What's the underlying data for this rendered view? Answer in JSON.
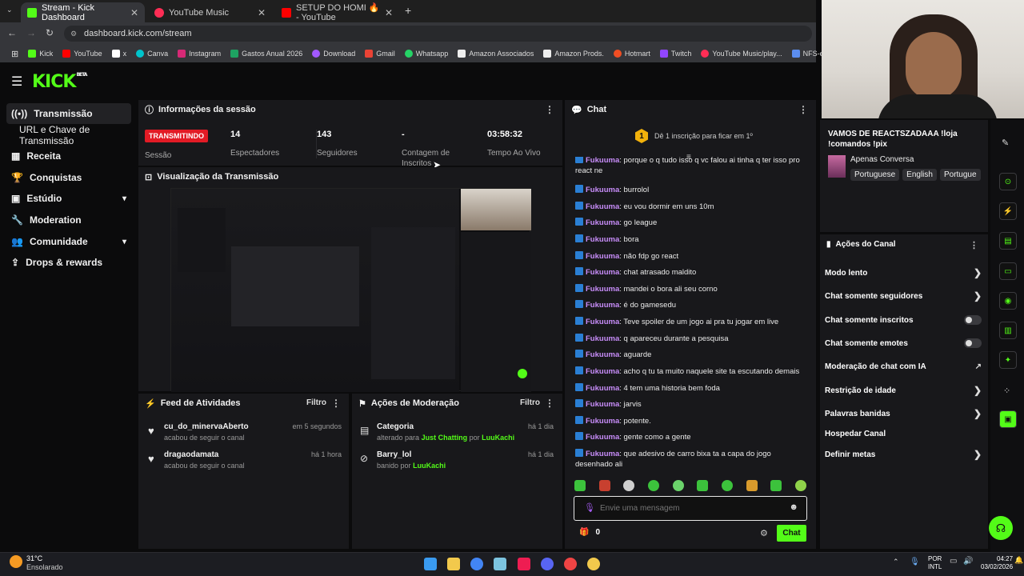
{
  "browser": {
    "tabs": [
      {
        "title": "Stream - Kick Dashboard",
        "close": "✕"
      },
      {
        "title": "YouTube Music",
        "close": "✕"
      },
      {
        "title": "SETUP DO HOMI 🔥 - YouTube",
        "close": "✕"
      }
    ],
    "new_tab": "+",
    "url": "dashboard.kick.com/stream",
    "bookmarks": [
      "Kick",
      "YouTube",
      "x",
      "Canva",
      "Instagram",
      "Gastos Anual 2026",
      "Download",
      "Gmail",
      "Whatsapp",
      "Amazon Associados",
      "Amazon Prods.",
      "Hotmart",
      "Twitch",
      "YouTube Music/play...",
      "NFS-e | JOÃO PESS..."
    ]
  },
  "brand": {
    "logo": "KICK",
    "beta": "BETA",
    "accent": "#53fc18"
  },
  "sidebar": {
    "items": [
      {
        "label": "Transmissão",
        "icon": "broadcast-icon"
      },
      {
        "label": "URL e Chave de Transmissão"
      },
      {
        "label": "Receita",
        "icon": "revenue-icon"
      },
      {
        "label": "Conquistas",
        "icon": "trophy-icon"
      },
      {
        "label": "Estúdio",
        "icon": "studio-icon",
        "chevron": "▾"
      },
      {
        "label": "Moderation",
        "icon": "wrench-icon"
      },
      {
        "label": "Comunidade",
        "icon": "community-icon",
        "chevron": "▾"
      },
      {
        "label": "Drops & rewards",
        "icon": "drops-icon"
      }
    ]
  },
  "session": {
    "title": "Informações da sessão",
    "status": "TRANSMITINDO",
    "status_label": "Sessão",
    "stats": [
      {
        "value": "14",
        "label": "Espectadores"
      },
      {
        "value": "143",
        "label": "Seguidores"
      },
      {
        "value": "-",
        "label": "Contagem de Inscritos"
      },
      {
        "value": "03:58:32",
        "label": "Tempo Ao Vivo"
      }
    ]
  },
  "preview": {
    "title": "Visualização da Transmissão"
  },
  "activity": {
    "title": "Feed de Atividades",
    "filter": "Filtro",
    "items": [
      {
        "user": "cu_do_minervaAberto",
        "text": "acabou de seguir o canal",
        "time": "em 5 segundos"
      },
      {
        "user": "dragaodamata",
        "text": "acabou de seguir o canal",
        "time": "há 1 hora"
      }
    ]
  },
  "moderation": {
    "title": "Ações de Moderação",
    "filter": "Filtro",
    "items": [
      {
        "title": "Categoria",
        "prefix": "alterado para",
        "target": "Just Chatting",
        "by": "por",
        "mod": "LuuKachi",
        "time": "há 1 dia"
      },
      {
        "title": "Barry_lol",
        "prefix": "banido",
        "by": "por",
        "mod": "LuuKachi",
        "time": "há 1 dia"
      }
    ]
  },
  "chat": {
    "title": "Chat",
    "sub_number": "1",
    "sub_text": "Dê 1 inscrição para ficar em 1º",
    "messages": [
      {
        "user": "Fukuuma",
        "text": "porque o q tudo isso q vc falou ai tinha q ter isso pro react ne"
      },
      {
        "user": "Fukuuma",
        "text": "burrolol"
      },
      {
        "user": "Fukuuma",
        "text": "eu vou dormir em uns 10m"
      },
      {
        "user": "Fukuuma",
        "text": "go league"
      },
      {
        "user": "Fukuuma",
        "text": "bora"
      },
      {
        "user": "Fukuuma",
        "text": "não fdp go react"
      },
      {
        "user": "Fukuuma",
        "text": "chat atrasado maldito"
      },
      {
        "user": "Fukuuma",
        "text": "mandei o bora ali seu corno"
      },
      {
        "user": "Fukuuma",
        "text": "é do gamesedu"
      },
      {
        "user": "Fukuuma",
        "text": "Teve spoiler de um jogo ai pra tu jogar em live"
      },
      {
        "user": "Fukuuma",
        "text": "q apareceu durante a pesquisa"
      },
      {
        "user": "Fukuuma",
        "text": "aguarde"
      },
      {
        "user": "Fukuuma",
        "text": "acho q tu ta muito naquele site ta escutando demais"
      },
      {
        "user": "Fukuuma",
        "text": "4 tem uma historia bem foda"
      },
      {
        "user": "Fukuuma",
        "text": "jarvis"
      },
      {
        "user": "Fukuuma",
        "text": "potente."
      },
      {
        "user": "Fukuuma",
        "text": "gente como a gente"
      },
      {
        "user": "Fukuuma",
        "text": "que adesivo de carro bixa ta a capa do jogo desenhado ali"
      }
    ],
    "placeholder": "Envie uma mensagem",
    "points": "0",
    "send": "Chat"
  },
  "channel": {
    "stream_title": "VAMOS DE REACTSZADAAA !loja !comandos !pix",
    "category": "Apenas Conversa",
    "languages": [
      "Portuguese",
      "English",
      "Portugue"
    ],
    "actions_title": "Ações do Canal",
    "actions": [
      {
        "label": "Modo lento",
        "type": "arrow"
      },
      {
        "label": "Chat somente seguidores",
        "type": "arrow"
      },
      {
        "label": "Chat somente inscritos",
        "type": "toggle"
      },
      {
        "label": "Chat somente emotes",
        "type": "toggle"
      },
      {
        "label": "Moderação de chat com IA",
        "type": "external"
      },
      {
        "label": "Restrição de idade",
        "type": "arrow"
      },
      {
        "label": "Palavras banidas",
        "type": "arrow"
      },
      {
        "label": "Hospedar Canal",
        "type": "none"
      },
      {
        "label": "Definir metas",
        "type": "arrow"
      }
    ]
  },
  "taskbar": {
    "weather_temp": "31°C",
    "weather_desc": "Ensolarado",
    "lang1": "POR",
    "lang2": "INTL",
    "time": "04:27",
    "date": "03/02/2026"
  }
}
